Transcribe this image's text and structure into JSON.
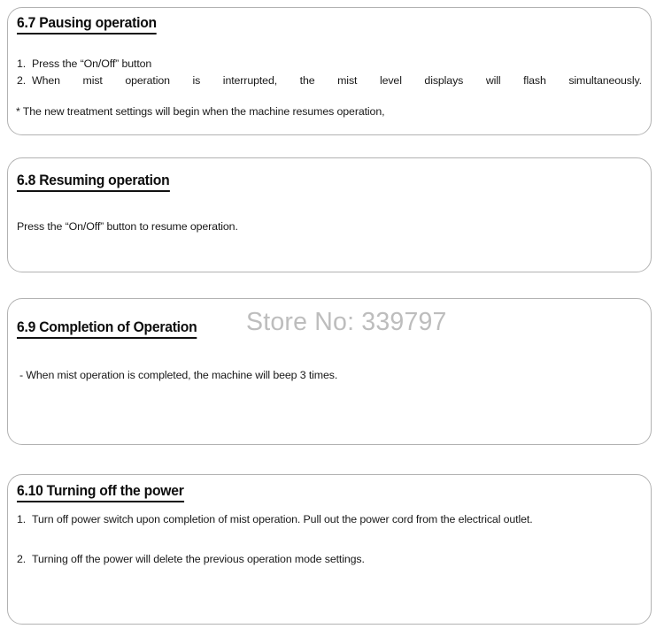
{
  "watermark": {
    "text": "Store No: 339797",
    "color": "#bdbdbd"
  },
  "theme": {
    "box_border_color": "#b2b2b2",
    "text_color": "#181818",
    "heading_color": "#0d0d0d",
    "page_background": "#ffffff"
  },
  "sections": [
    {
      "id": "6.7",
      "heading": "6.7 Pausing operation",
      "items": [
        {
          "marker": "1.",
          "text": "Press the “On/Off” button"
        },
        {
          "marker": "2.",
          "text": "When mist operation is interrupted, the mist level displays will flash simultaneously."
        }
      ],
      "note": "* The new treatment settings will begin when the machine resumes operation,"
    },
    {
      "id": "6.8",
      "heading": "6.8 Resuming operation",
      "body": "Press the “On/Off” button to resume operation."
    },
    {
      "id": "6.9",
      "heading": "6.9 Completion of Operation",
      "body": "- When mist operation is completed, the machine will beep 3 times."
    },
    {
      "id": "6.10",
      "heading": "6.10 Turning off the power",
      "items": [
        {
          "marker": "1.",
          "text": "Turn off power switch upon completion of mist operation. Pull out the power cord from the electrical outlet."
        },
        {
          "marker": "2.",
          "text": "Turning off the power will delete the previous operation mode settings."
        }
      ]
    }
  ]
}
